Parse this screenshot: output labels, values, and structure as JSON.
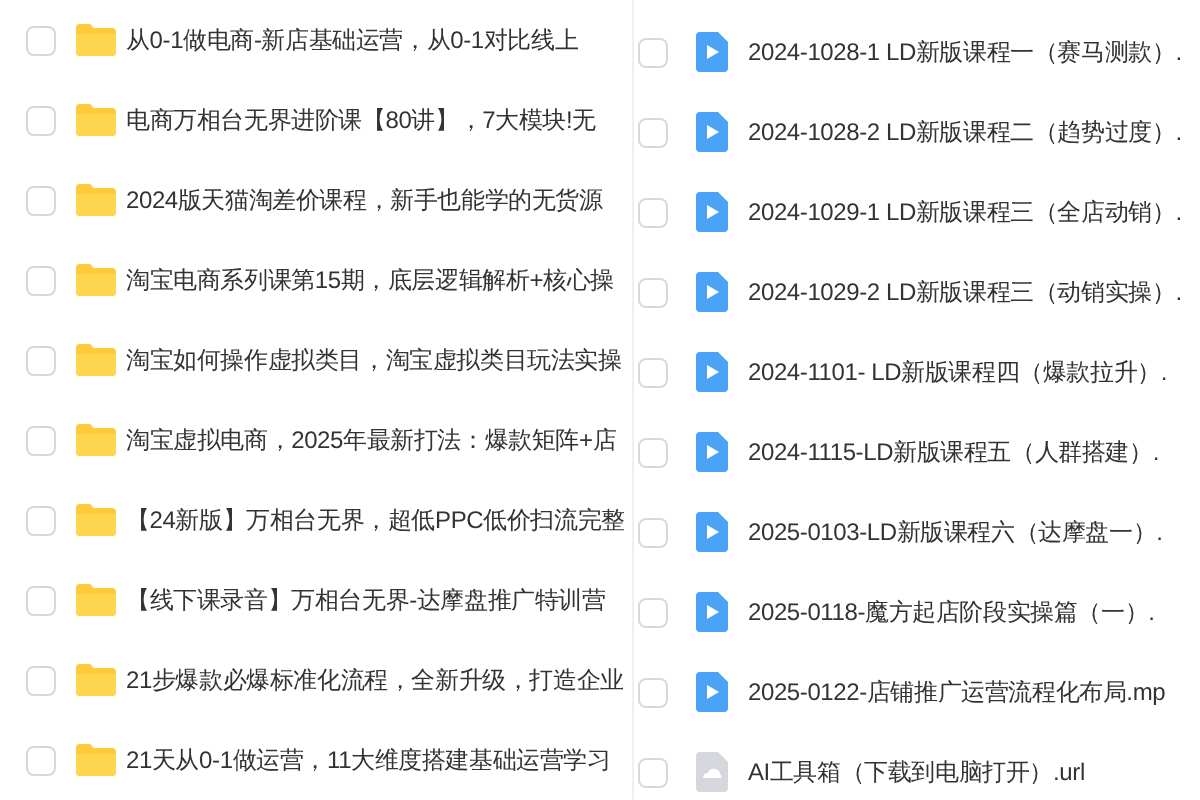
{
  "left_files": [
    {
      "name": "从0-1做电商-新店基础运营，从0-1对比线上",
      "kind": "folder",
      "checked": false
    },
    {
      "name": "电商万相台无界进阶课【80讲】，7大模块!无",
      "kind": "folder",
      "checked": false
    },
    {
      "name": "2024版天猫淘差价课程，新手也能学的无货源",
      "kind": "folder",
      "checked": false
    },
    {
      "name": "淘宝电商系列课第15期，底层逻辑解析+核心操",
      "kind": "folder",
      "checked": false
    },
    {
      "name": "淘宝如何操作虚拟类目，淘宝虚拟类目玩法实操",
      "kind": "folder",
      "checked": false
    },
    {
      "name": "淘宝虚拟电商，2025年最新打法：爆款矩阵+店",
      "kind": "folder",
      "checked": false
    },
    {
      "name": "【24新版】万相台无界，超低PPC低价扫流完整",
      "kind": "folder",
      "checked": false
    },
    {
      "name": "【线下课录音】万相台无界-达摩盘推广特训营",
      "kind": "folder",
      "checked": false
    },
    {
      "name": "21步爆款必爆标准化流程，全新升级，打造企业",
      "kind": "folder",
      "checked": false
    },
    {
      "name": "21天从0-1做运营，11大维度搭建基础运营学习",
      "kind": "folder",
      "checked": false
    }
  ],
  "right_files": [
    {
      "name": "2024-1028-1 LD新版课程一（赛马测款）.",
      "kind": "video",
      "checked": false
    },
    {
      "name": "2024-1028-2 LD新版课程二（趋势过度）.",
      "kind": "video",
      "checked": false
    },
    {
      "name": "2024-1029-1 LD新版课程三（全店动销）.",
      "kind": "video",
      "checked": false
    },
    {
      "name": "2024-1029-2 LD新版课程三（动销实操）.",
      "kind": "video",
      "checked": false
    },
    {
      "name": "2024-1101- LD新版课程四（爆款拉升）.",
      "kind": "video",
      "checked": false
    },
    {
      "name": "2024-1115-LD新版课程五（人群搭建）.",
      "kind": "video",
      "checked": false
    },
    {
      "name": "2025-0103-LD新版课程六（达摩盘一）.",
      "kind": "video",
      "checked": false
    },
    {
      "name": "2025-0118-魔方起店阶段实操篇（一）.",
      "kind": "video",
      "checked": false
    },
    {
      "name": "2025-0122-店铺推广运营流程化布局.mp",
      "kind": "video",
      "checked": false
    },
    {
      "name": "AI工具箱（下载到电脑打开）.url",
      "kind": "link",
      "checked": false
    }
  ]
}
